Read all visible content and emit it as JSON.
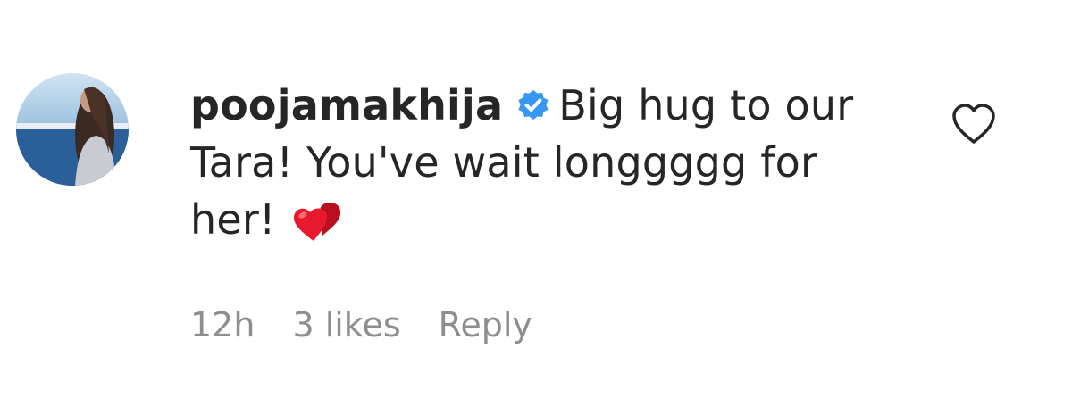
{
  "comment": {
    "username": "poojamakhija",
    "text_line": "Big hug to our Tara! You've wait longgggg for her!",
    "emoji": "red-hearts",
    "timestamp": "12h",
    "likes": "3 likes",
    "reply_label": "Reply"
  },
  "icons": {
    "verified_badge": "verified-badge-icon",
    "like_button": "heart-outline-icon",
    "emoji": "two-hearts-icon"
  },
  "colors": {
    "text": "#262626",
    "muted": "#8e8e8e",
    "verified": "#3897f0",
    "emoji_red": "#e8192c"
  }
}
